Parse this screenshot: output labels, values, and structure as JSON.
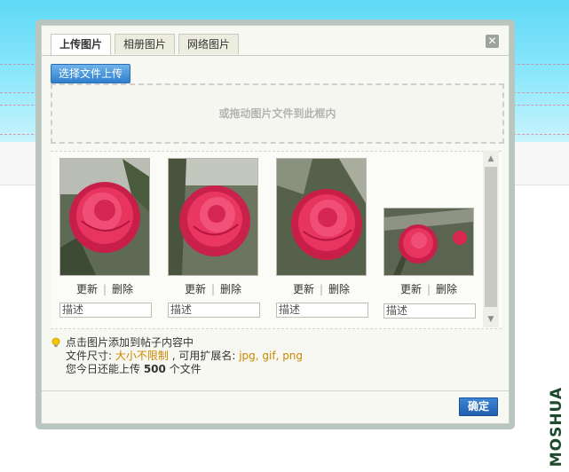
{
  "dialog": {
    "tabs": [
      {
        "label": "上传图片",
        "active": true
      },
      {
        "label": "相册图片",
        "active": false
      },
      {
        "label": "网络图片",
        "active": false
      }
    ],
    "close_glyph": "✕",
    "select_button": "选择文件上传",
    "drop_zone_text": "或拖动图片文件到此框内",
    "photos": [
      {
        "action_update": "更新",
        "action_delete": "删除",
        "separator": "|",
        "desc_placeholder": "描述"
      },
      {
        "action_update": "更新",
        "action_delete": "删除",
        "separator": "|",
        "desc_placeholder": "描述"
      },
      {
        "action_update": "更新",
        "action_delete": "删除",
        "separator": "|",
        "desc_placeholder": "描述"
      },
      {
        "action_update": "更新",
        "action_delete": "删除",
        "separator": "|",
        "desc_placeholder": "描述"
      }
    ],
    "tips": {
      "line1": "点击图片添加到帖子内容中",
      "size_label": "文件尺寸: ",
      "size_value": "大小不限制",
      "ext_label": " , 可用扩展名: ",
      "ext_value": "jpg, gif, png",
      "quota_prefix": "您今日还能上传 ",
      "quota_count": "500",
      "quota_suffix": " 个文件"
    },
    "confirm_button": "确定"
  },
  "watermark": "MOSHUA",
  "colors": {
    "accent_blue": "#2f7fcf",
    "highlight": "#c98800",
    "flower": "#e8355f"
  }
}
